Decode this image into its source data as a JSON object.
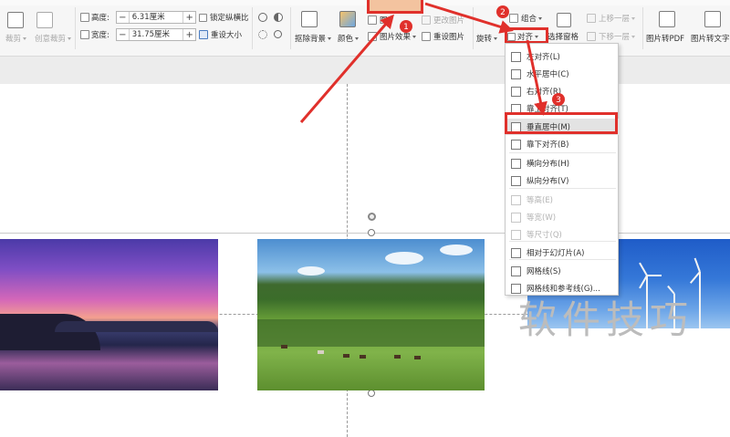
{
  "ribbon": {
    "crop_label": "裁剪",
    "creative_crop_label": "创意裁剪",
    "height_label": "高度:",
    "height_value": "6.31厘米",
    "width_label": "宽度:",
    "width_value": "31.75厘米",
    "lock_ratio_label": "锁定纵横比",
    "reset_size_label": "重设大小",
    "remove_bg_label": "抠除背景",
    "color_label": "颜色",
    "picture_effects_label": "图片效果",
    "change_picture_label": "更改图片",
    "reset_picture_label": "重设图片",
    "rotate_label": "旋转",
    "align_label": "对齐",
    "selection_pane_label": "选择窗格",
    "group_label": "组合",
    "bring_forward_label": "上移一层",
    "send_backward_label": "下移一层",
    "pic_to_pdf_label": "图片转PDF",
    "pic_to_text_label": "图片转文字"
  },
  "annotations": {
    "step1": "1",
    "step2": "2",
    "step3": "3",
    "accent_color": "#e0302b"
  },
  "align_menu": {
    "items": [
      {
        "label": "左对齐(L)",
        "disabled": false
      },
      {
        "label": "水平居中(C)",
        "disabled": false
      },
      {
        "label": "右对齐(R)",
        "disabled": false
      },
      {
        "label": "靠上对齐(T)",
        "disabled": false
      },
      {
        "label": "垂直居中(M)",
        "disabled": false,
        "selected": true
      },
      {
        "label": "靠下对齐(B)",
        "disabled": false
      },
      {
        "label": "横向分布(H)",
        "disabled": false
      },
      {
        "label": "纵向分布(V)",
        "disabled": false
      },
      {
        "label": "等高(E)",
        "disabled": true
      },
      {
        "label": "等宽(W)",
        "disabled": true
      },
      {
        "label": "等尺寸(Q)",
        "disabled": true
      },
      {
        "label": "相对于幻灯片(A)",
        "disabled": false
      },
      {
        "label": "网格线(S)",
        "disabled": false
      },
      {
        "label": "网格线和参考线(G)...",
        "disabled": false
      }
    ]
  },
  "watermark": {
    "text": "软件技巧"
  }
}
